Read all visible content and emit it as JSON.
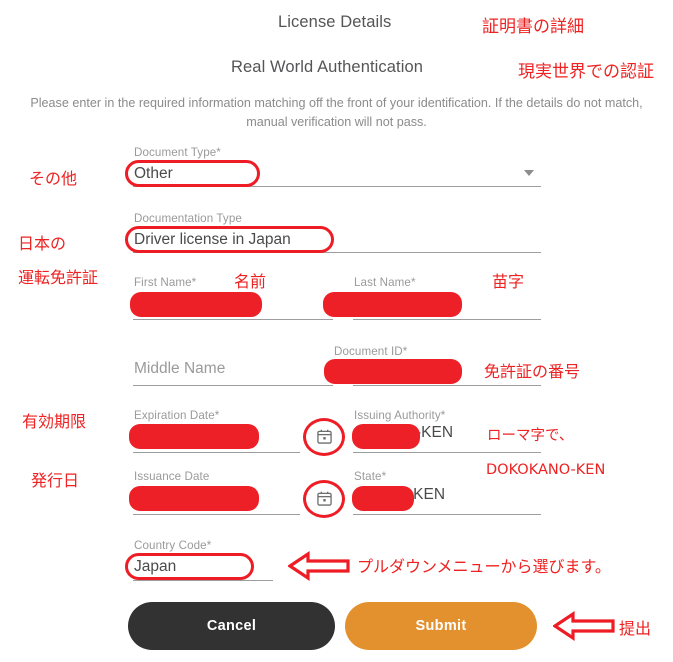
{
  "header": {
    "title": "License Details",
    "title_note": "証明書の詳細",
    "subtitle": "Real World Authentication",
    "subtitle_note": "現実世界での認証",
    "intro": "Please enter in the required information matching off the front of your identification. If the details do not match, manual verification will not pass."
  },
  "annotations": {
    "other": "その他",
    "japan_line1": "日本の",
    "japan_line2": "運転免許証",
    "first_name": "名前",
    "last_name": "苗字",
    "document_id": "免許証の番号",
    "expiration": "有効期限",
    "issuance": "発行日",
    "romaji_line1": "ローマ字で、",
    "romaji_line2": "DOKOKANO-KEN",
    "country_code": "プルダウンメニューから選びます。",
    "submit": "提出"
  },
  "form": {
    "document_type": {
      "label": "Document Type*",
      "value": "Other",
      "icon": "chevron-down-icon"
    },
    "documentation_type": {
      "label": "Documentation Type",
      "value": "Driver license in Japan"
    },
    "first_name": {
      "label": "First Name*",
      "value": "",
      "redacted": true
    },
    "last_name": {
      "label": "Last Name*",
      "value": "",
      "redacted": true
    },
    "middle_name": {
      "label": "",
      "placeholder": "Middle Name",
      "value": ""
    },
    "document_id": {
      "label": "Document ID*",
      "value": "",
      "redacted": true
    },
    "expiration_date": {
      "label": "Expiration Date*",
      "value": "",
      "redacted": true,
      "icon": "calendar-icon"
    },
    "issuing_authority": {
      "label": "Issuing Authority*",
      "value": "-KEN",
      "redacted": true
    },
    "issuance_date": {
      "label": "Issuance Date",
      "value": "",
      "redacted": true,
      "icon": "calendar-icon"
    },
    "state": {
      "label": "State*",
      "value": "-KEN",
      "redacted": true
    },
    "country_code": {
      "label": "Country Code*",
      "value": "Japan"
    }
  },
  "buttons": {
    "cancel": "Cancel",
    "submit": "Submit"
  },
  "colors": {
    "annotation_red": "#ee1c24",
    "redaction_red": "#ee2027",
    "submit_orange": "#e3912f",
    "cancel_dark": "#323232",
    "label_gray": "#9a9a9c",
    "underline_gray": "#9d9d9f"
  }
}
